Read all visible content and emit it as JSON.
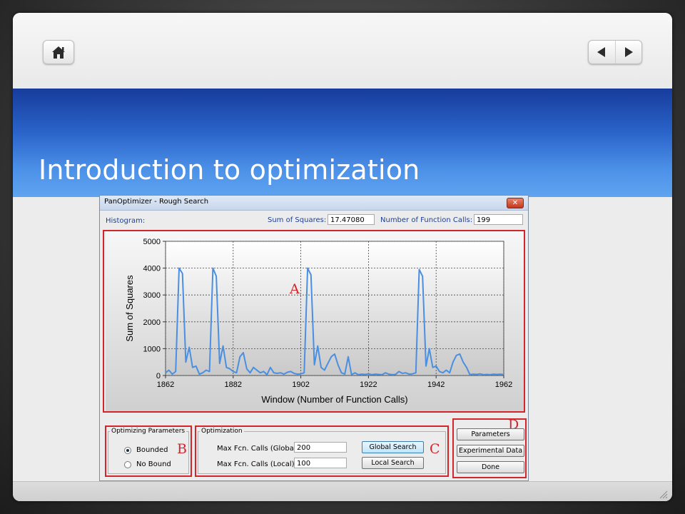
{
  "slide": {
    "title": "Introduction to optimization",
    "nav": {
      "home": "home-icon",
      "prev": "triangle-left-icon",
      "next": "triangle-right-icon"
    }
  },
  "window": {
    "title": "PanOptimizer - Rough Search",
    "histogram_label": "Histogram:",
    "sum_of_squares_label": "Sum of Squares:",
    "sum_of_squares_value": "17.47080",
    "function_calls_label": "Number of Function Calls:",
    "function_calls_value": "199",
    "close_glyph": "✕"
  },
  "annotations": {
    "a": "A",
    "b": "B",
    "c": "C",
    "d": "D"
  },
  "optimizing_parameters": {
    "title": "Optimizing Parameters",
    "options": [
      {
        "label": "Bounded",
        "selected": true
      },
      {
        "label": "No Bound",
        "selected": false
      }
    ]
  },
  "optimization": {
    "title": "Optimization",
    "global_label": "Max Fcn. Calls (Global):",
    "global_value": "200",
    "local_label": "Max Fcn. Calls (Local):",
    "local_value": "100",
    "global_button": "Global Search",
    "local_button": "Local Search"
  },
  "side_buttons": [
    "Parameters",
    "Experimental Data",
    "Done"
  ],
  "colors": {
    "series": "#4a8fe0",
    "annotation": "#d3262c",
    "title_band": "#2a63c8"
  },
  "chart_data": {
    "type": "line",
    "xlabel": "Window (Number of Function Calls)",
    "ylabel": "Sum of Squares",
    "xlim": [
      1862,
      1962
    ],
    "ylim": [
      0,
      5000
    ],
    "xticks": [
      1862,
      1882,
      1902,
      1922,
      1942,
      1962
    ],
    "yticks": [
      0,
      1000,
      2000,
      3000,
      4000,
      5000
    ],
    "grid": true,
    "series": [
      {
        "x": [
          1862,
          1863,
          1864,
          1865,
          1866,
          1867,
          1868,
          1869,
          1870,
          1871,
          1872,
          1873,
          1874,
          1875,
          1876,
          1877,
          1878,
          1879,
          1880,
          1881,
          1882,
          1883,
          1884,
          1885,
          1886,
          1887,
          1888,
          1889,
          1890,
          1891,
          1892,
          1893,
          1894,
          1895,
          1896,
          1897,
          1898,
          1899,
          1900,
          1901,
          1902,
          1903,
          1904,
          1905,
          1906,
          1907,
          1908,
          1909,
          1910,
          1911,
          1912,
          1913,
          1914,
          1915,
          1916,
          1917,
          1918,
          1919,
          1920,
          1921,
          1922,
          1923,
          1924,
          1925,
          1926,
          1927,
          1928,
          1929,
          1930,
          1931,
          1932,
          1933,
          1934,
          1935,
          1936,
          1937,
          1938,
          1939,
          1940,
          1941,
          1942,
          1943,
          1944,
          1945,
          1946,
          1947,
          1948,
          1949,
          1950,
          1951,
          1952,
          1953,
          1954,
          1955,
          1956,
          1957,
          1958,
          1959,
          1960,
          1961,
          1962
        ],
        "y": [
          100,
          200,
          50,
          150,
          4000,
          3800,
          500,
          1050,
          300,
          350,
          50,
          100,
          200,
          150,
          4000,
          3700,
          450,
          1100,
          300,
          250,
          150,
          100,
          700,
          850,
          250,
          100,
          300,
          200,
          100,
          150,
          30,
          300,
          100,
          80,
          100,
          50,
          120,
          150,
          80,
          50,
          60,
          100,
          4000,
          3750,
          400,
          1100,
          300,
          200,
          450,
          700,
          800,
          400,
          100,
          50,
          700,
          30,
          100,
          30,
          50,
          40,
          60,
          30,
          50,
          40,
          30,
          100,
          50,
          30,
          40,
          150,
          80,
          100,
          50,
          60,
          100,
          3950,
          3700,
          350,
          1000,
          300,
          350,
          150,
          100,
          200,
          100,
          500,
          750,
          800,
          500,
          300,
          30,
          50,
          40,
          60,
          30,
          40,
          30,
          50,
          40,
          50,
          30
        ]
      }
    ]
  }
}
